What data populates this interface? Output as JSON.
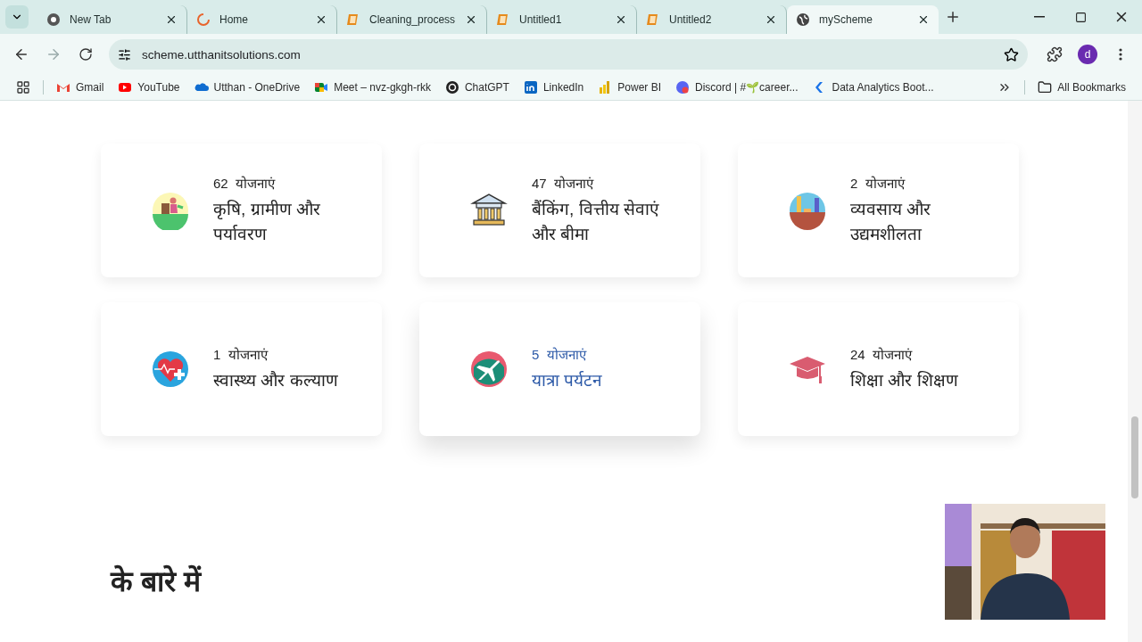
{
  "tabs": [
    {
      "title": "New Tab",
      "kind": "chrome",
      "selected": false
    },
    {
      "title": "Home",
      "kind": "loading",
      "selected": false
    },
    {
      "title": "Cleaning_process",
      "kind": "notebook",
      "selected": false
    },
    {
      "title": "Untitled1",
      "kind": "notebook",
      "selected": false
    },
    {
      "title": "Untitled2",
      "kind": "notebook",
      "selected": false
    },
    {
      "title": "myScheme",
      "kind": "globe",
      "selected": true
    }
  ],
  "address_bar": {
    "url": "scheme.utthanitsolutions.com"
  },
  "profile": "d",
  "bookmarks": [
    {
      "label": "Gmail",
      "kind": "gmail"
    },
    {
      "label": "YouTube",
      "kind": "youtube"
    },
    {
      "label": "Utthan - OneDrive",
      "kind": "cloud"
    },
    {
      "label": "Meet – nvz-gkgh-rkk",
      "kind": "meet"
    },
    {
      "label": "ChatGPT",
      "kind": "chatgpt"
    },
    {
      "label": "LinkedIn",
      "kind": "linkedin"
    },
    {
      "label": "Power BI",
      "kind": "powerbi"
    },
    {
      "label": "Discord | #🌱career...",
      "kind": "discord"
    },
    {
      "label": "Data Analytics Boot...",
      "kind": "edu"
    }
  ],
  "all_bookmarks": "All Bookmarks",
  "cards": [
    {
      "count": "62",
      "unit": "योजनाएं",
      "title": "कृषि, ग्रामीण और पर्यावरण",
      "kind": "farmer",
      "hovered": false
    },
    {
      "count": "47",
      "unit": "योजनाएं",
      "title": "बैंकिंग, वित्तीय सेवाएं और बीमा",
      "kind": "bank",
      "hovered": false
    },
    {
      "count": "2",
      "unit": "योजनाएं",
      "title": "व्यवसाय और उद्यमशीलता",
      "kind": "business",
      "hovered": false
    },
    {
      "count": "1",
      "unit": "योजनाएं",
      "title": "स्वास्थ्य और कल्याण",
      "kind": "health",
      "hovered": false
    },
    {
      "count": "5",
      "unit": "योजनाएं",
      "title": "यात्रा पर्यटन",
      "kind": "travel",
      "hovered": true
    },
    {
      "count": "24",
      "unit": "योजनाएं",
      "title": "शिक्षा और शिक्षण",
      "kind": "education",
      "hovered": false
    }
  ],
  "section_heading": "के बारे में"
}
